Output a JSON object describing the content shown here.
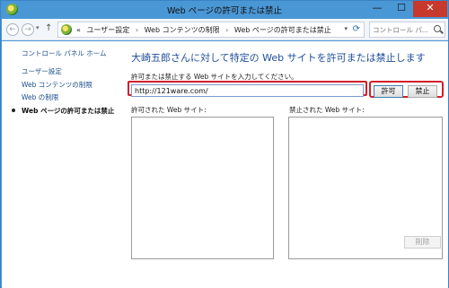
{
  "window": {
    "title": "Web ページの許可または禁止",
    "minimize_glyph": "—",
    "maximize_glyph": "☐",
    "close_glyph": "✕"
  },
  "address_bar": {
    "prefix": "«",
    "crumbs": [
      "ユーザー設定",
      "Web コンテンツの制限",
      "Web ページの許可または禁止"
    ],
    "separator": "›",
    "search_placeholder": "コントロール パ..."
  },
  "sidebar": {
    "home": "コントロール パネル ホーム",
    "items": [
      {
        "label": "ユーザー設定",
        "active": false
      },
      {
        "label": "Web コンテンツの制限",
        "active": false
      },
      {
        "label": "Web の制限",
        "active": false
      },
      {
        "label": "Web ページの許可または禁止",
        "active": true
      }
    ]
  },
  "main": {
    "title": "大崎五郎さんに対して特定の Web サイトを許可または禁止します",
    "url_label": "許可または禁止する Web サイトを入力してください。",
    "url_value": "http://121ware.com/",
    "allow_button": "許可",
    "block_button": "禁止",
    "allowed_list_label": "許可された Web サイト:",
    "blocked_list_label": "禁止された Web サイト:",
    "delete_button": "削除"
  },
  "colors": {
    "titlebar": "#4a97d6",
    "highlight": "#d21f2a",
    "link": "#1b4f8b",
    "heading": "#1e4d9a"
  }
}
